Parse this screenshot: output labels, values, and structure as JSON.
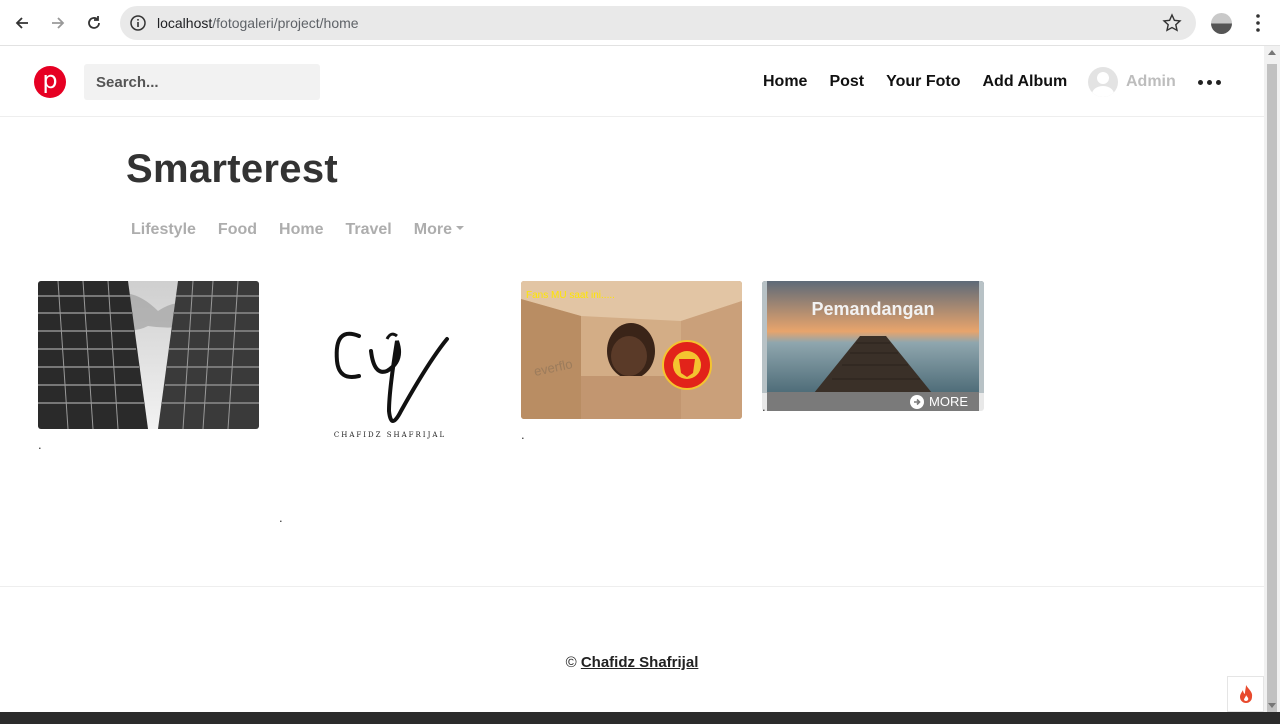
{
  "browser": {
    "url_host": "localhost",
    "url_path": "/fotogaleri/project/home"
  },
  "header": {
    "logo_letter": "p",
    "search_placeholder": "Search...",
    "nav": [
      "Home",
      "Post",
      "Your Foto",
      "Add Album"
    ],
    "user_name": "Admin"
  },
  "main": {
    "title": "Smarterest",
    "categories": [
      "Lifestyle",
      "Food",
      "Home",
      "Travel",
      "More"
    ],
    "cards": [
      {
        "caption": "."
      },
      {
        "signature_initials": "CS",
        "signature_name": "CHAFIDZ SHAFRIJAL",
        "caption": "."
      },
      {
        "overlay_text": "Fans MU saat ini.....",
        "badge_text": "MANCHESTER UNITED",
        "caption": "."
      },
      {
        "album_title": "Pemandangan",
        "more_label": "MORE",
        "caption": "."
      }
    ]
  },
  "footer": {
    "copyright": "©",
    "author": "Chafidz Shafrijal"
  },
  "colors": {
    "brand": "#e60023",
    "text_dark": "#333333",
    "muted": "#adadad"
  }
}
